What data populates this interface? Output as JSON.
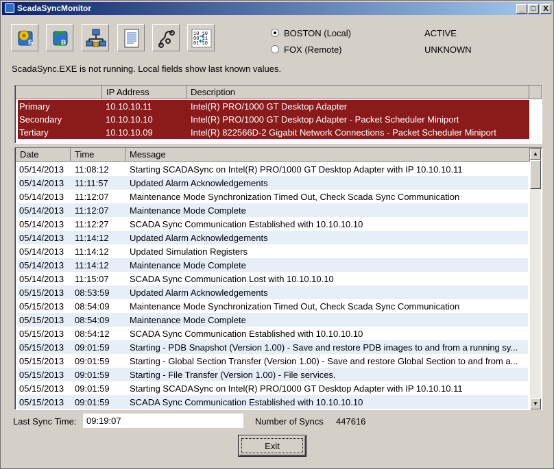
{
  "window": {
    "title": "ScadaSyncMonitor",
    "minimize": "_",
    "maximize": "□",
    "close": "X"
  },
  "toolbar": {
    "icons": [
      "sync-primary-icon",
      "sync-secondary-icon",
      "network-icon",
      "document-icon",
      "connector-icon",
      "binary-data-icon"
    ]
  },
  "sites": [
    {
      "label": "BOSTON (Local)",
      "status": "ACTIVE",
      "selected": true
    },
    {
      "label": "FOX  (Remote)",
      "status": "UNKNOWN",
      "selected": false
    }
  ],
  "notice": "ScadaSync.EXE is not running.  Local fields show last known values.",
  "adapters": {
    "headers": [
      "",
      "IP Address",
      "Description"
    ],
    "rows": [
      {
        "name": "Primary",
        "ip": "10.10.10.11",
        "description": "Intel(R) PRO/1000 GT Desktop Adapter"
      },
      {
        "name": "Secondary",
        "ip": "10.10.10.10",
        "description": "Intel(R) PRO/1000 GT Desktop Adapter  - Packet  Scheduler Miniport"
      },
      {
        "name": "Tertiary",
        "ip": "10.10.10.09",
        "description": "Intel(R) 822566D-2 Gigabit Network Connections  - Packet Scheduler Miniport"
      }
    ],
    "highlight_color": "#8b1a1a"
  },
  "log": {
    "headers": [
      "Date",
      "Time",
      "Message"
    ],
    "rows": [
      {
        "date": "05/14/2013",
        "time": "11:08:12",
        "message": "Starting SCADASync on Intel(R) PRO/1000 GT Desktop Adapter with IP 10.10.10.11"
      },
      {
        "date": "05/14/2013",
        "time": "11:11:57",
        "message": "Updated Alarm Acknowledgements"
      },
      {
        "date": "05/14/2013",
        "time": "11:12:07",
        "message": "Maintenance Mode Synchronization Timed Out, Check Scada Sync Communication"
      },
      {
        "date": "05/14/2013",
        "time": "11:12:07",
        "message": "Maintenance Mode Complete"
      },
      {
        "date": "05/14/2013",
        "time": "11:12:27",
        "message": "SCADA Sync Communication Established with 10.10.10.10"
      },
      {
        "date": "05/14/2013",
        "time": "11:14:12",
        "message": "Updated Alarm Acknowledgements"
      },
      {
        "date": "05/14/2013",
        "time": "11:14:12",
        "message": "Updated Simulation Registers"
      },
      {
        "date": "05/14/2013",
        "time": "11:14:12",
        "message": "Maintenance Mode Complete"
      },
      {
        "date": "05/14/2013",
        "time": "11:15:07",
        "message": "SCADA Sync Communication Lost with 10.10.10.10"
      },
      {
        "date": "05/15/2013",
        "time": "08:53:59",
        "message": "Updated Alarm Acknowledgements"
      },
      {
        "date": "05/15/2013",
        "time": "08:54:09",
        "message": "Maintenance Mode Synchronization Timed Out, Check Scada Sync Communication"
      },
      {
        "date": "05/15/2013",
        "time": "08:54:09",
        "message": "Maintenance Mode Complete"
      },
      {
        "date": "05/15/2013",
        "time": "08:54:12",
        "message": "SCADA Sync Communication Established with 10.10.10.10"
      },
      {
        "date": "05/15/2013",
        "time": "09:01:59",
        "message": "Starting - PDB Snapshot (Version 1.00) -  Save and restore PDB images to and from a running sy..."
      },
      {
        "date": "05/15/2013",
        "time": "09:01:59",
        "message": "Starting - Global Section Transfer (Version 1.00) -  Save and restore Global Section to and from a..."
      },
      {
        "date": "05/15/2013",
        "time": "09:01:59",
        "message": "Starting - File Transfer (Version 1.00) -  File services."
      },
      {
        "date": "05/15/2013",
        "time": "09:01:59",
        "message": "Starting SCADASync on Intel(R) PRO/1000 GT Desktop Adapter with IP 10.10.10.11"
      },
      {
        "date": "05/15/2013",
        "time": "09:01:59",
        "message": "SCADA Sync Communication Established with 10.10.10.10"
      }
    ],
    "scroll_up": "▲",
    "scroll_down": "▼"
  },
  "footer": {
    "last_sync_label": "Last Sync Time:",
    "last_sync_value": "09:19:07",
    "num_syncs_label": "Number of Syncs",
    "num_syncs_value": "447616",
    "exit_label": "Exit"
  }
}
